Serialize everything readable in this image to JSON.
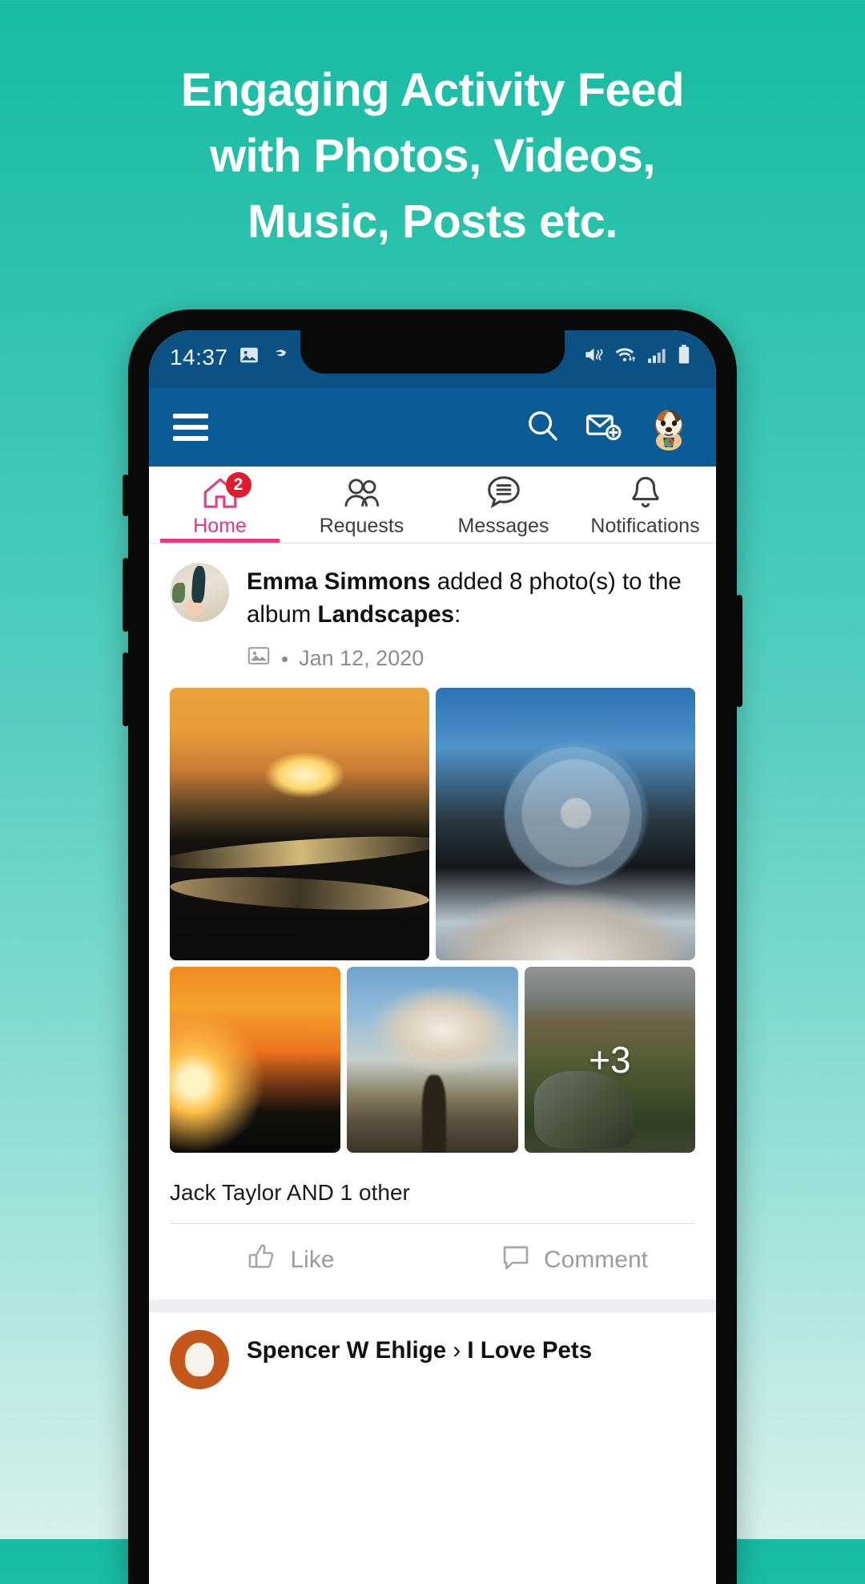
{
  "promo": {
    "headline_lines": [
      "Engaging Activity Feed",
      "with Photos, Videos,",
      "Music, Posts etc."
    ],
    "background_top_color": "#17bba2",
    "background_bottom_color": "#d7f0ec"
  },
  "status_bar": {
    "time": "14:37",
    "left_icons": [
      "image-icon",
      "app-icon"
    ],
    "right_icons": [
      "mute-vibrate-icon",
      "wifi-icon",
      "signal-bars-icon",
      "battery-icon"
    ],
    "background_color": "#0b5183"
  },
  "app_bar": {
    "menu_icon": "hamburger-menu-icon",
    "search_icon": "search-icon",
    "messages_icon": "new-message-envelope-icon",
    "avatar_icon": "user-avatar-dog",
    "background_color": "#0b5c96"
  },
  "tabs": {
    "accent_color": "#e8397f",
    "badge_color": "#e01b2e",
    "items": [
      {
        "label": "Home",
        "icon": "home-icon",
        "active": true,
        "badge": "2"
      },
      {
        "label": "Requests",
        "icon": "people-icon",
        "active": false,
        "badge": ""
      },
      {
        "label": "Messages",
        "icon": "chat-bubble-icon",
        "active": false,
        "badge": ""
      },
      {
        "label": "Notifications",
        "icon": "bell-icon",
        "active": false,
        "badge": ""
      }
    ]
  },
  "feed": {
    "post": {
      "author": "Emma Simmons",
      "action_text": " added 8 photo(s) to the album ",
      "album": "Landscapes",
      "colon": ":",
      "meta_icon": "image-icon",
      "meta_separator": "•",
      "date": "Jan 12, 2020",
      "photos_row1": [
        {
          "name": "sunset-river-photo",
          "alt": "sunset over winding river"
        },
        {
          "name": "frozen-bubble-photo",
          "alt": "frozen soap bubble at sunset"
        }
      ],
      "photos_row2": [
        {
          "name": "reeds-sunset-photo",
          "alt": "reeds against orange sunset"
        },
        {
          "name": "lone-tree-photo",
          "alt": "lone tree with clouds"
        },
        {
          "name": "valley-photo",
          "alt": "green valley with rocks",
          "overlay": "+3"
        }
      ],
      "likers": "Jack Taylor AND 1 other",
      "actions": [
        {
          "label": "Like",
          "icon": "thumbs-up-icon"
        },
        {
          "label": "Comment",
          "icon": "comment-bubble-icon"
        }
      ]
    },
    "next_post": {
      "author": "Spencer W Ehlige",
      "separator": "›",
      "target": "I Love Pets"
    }
  }
}
